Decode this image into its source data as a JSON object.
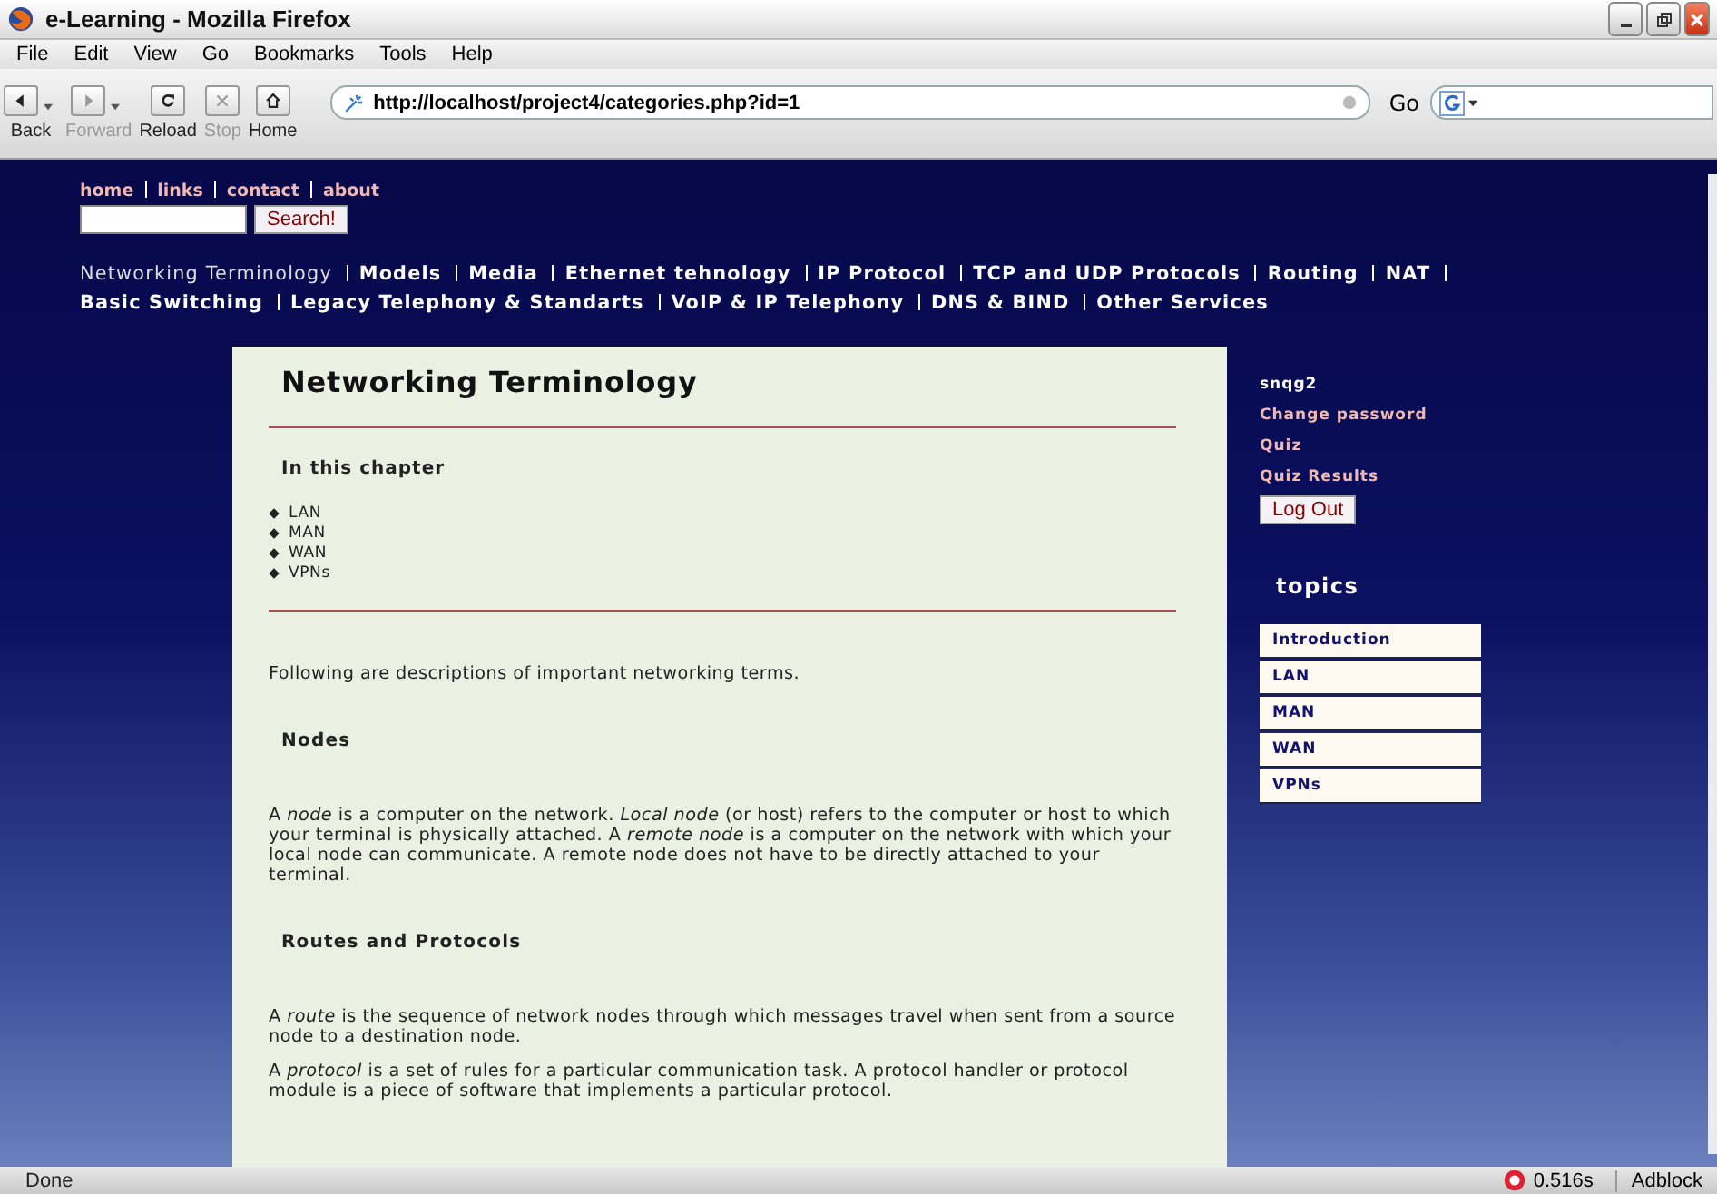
{
  "window": {
    "title": "e-Learning - Mozilla Firefox"
  },
  "menu": [
    "File",
    "Edit",
    "View",
    "Go",
    "Bookmarks",
    "Tools",
    "Help"
  ],
  "toolbar": [
    {
      "kind": "back",
      "label": "Back",
      "disabled": false,
      "dropdown": true
    },
    {
      "kind": "forward",
      "label": "Forward",
      "disabled": true,
      "dropdown": true
    },
    {
      "kind": "reload",
      "label": "Reload",
      "disabled": false,
      "dropdown": false
    },
    {
      "kind": "stop",
      "label": "Stop",
      "disabled": true,
      "dropdown": false
    },
    {
      "kind": "home",
      "label": "Home",
      "disabled": false,
      "dropdown": false
    }
  ],
  "address": {
    "value": "http://localhost/project4/categories.php?id=1",
    "go_label": "Go"
  },
  "site": {
    "top_links": [
      "home",
      "links",
      "contact",
      "about"
    ],
    "search": {
      "button": "Search!"
    },
    "categories": [
      {
        "label": "Networking Terminology",
        "selected": true
      },
      {
        "label": "Models",
        "selected": false
      },
      {
        "label": "Media",
        "selected": false
      },
      {
        "label": "Ethernet tehnology",
        "selected": false
      },
      {
        "label": "IP Protocol",
        "selected": false
      },
      {
        "label": "TCP and UDP Protocols",
        "selected": false
      },
      {
        "label": "Routing",
        "selected": false
      },
      {
        "label": "NAT",
        "selected": false
      },
      {
        "label": "Basic Switching",
        "selected": false
      },
      {
        "label": "Legacy Telephony & Standarts",
        "selected": false
      },
      {
        "label": "VoIP & IP Telephony",
        "selected": false
      },
      {
        "label": "DNS & BIND",
        "selected": false
      },
      {
        "label": "Other Services",
        "selected": false
      }
    ],
    "article": {
      "title": "Networking Terminology",
      "chapter_heading": "In this chapter",
      "chapter_items": [
        "LAN",
        "MAN",
        "WAN",
        "VPNs"
      ],
      "intro": "Following are descriptions of important networking terms.",
      "sections": [
        {
          "heading": "Nodes",
          "paragraphs": [
            "A *node* is a computer on the network. *Local node* (or host) refers to the computer or host to which your terminal is physically attached. A *remote node* is a computer on the network with which your local node can communicate. A remote node does not have to be directly attached to your terminal."
          ]
        },
        {
          "heading": "Routes and Protocols",
          "paragraphs": [
            "A *route* is the sequence of network nodes through which messages travel when sent from a source node to a destination node.",
            "A *protocol* is a set of rules for a particular communication task. A protocol handler or protocol module is a piece of software that implements a particular protocol."
          ]
        }
      ]
    },
    "sidebar": {
      "user": "snqg2",
      "links": [
        "Change password",
        "Quiz",
        "Quiz Results"
      ],
      "logout": "Log Out",
      "topics_heading": "topics",
      "topics": [
        "Introduction",
        "LAN",
        "MAN",
        "WAN",
        "VPNs"
      ]
    }
  },
  "status_bar": {
    "text": "Done",
    "timing": "0.516s",
    "adblock": "Adblock"
  }
}
